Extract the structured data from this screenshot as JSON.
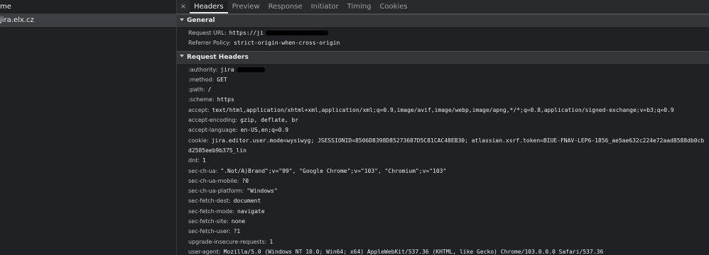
{
  "list": {
    "header": "me",
    "items": [
      {
        "label": "jira.elx.cz"
      }
    ]
  },
  "tabs": {
    "close": "×",
    "items": [
      {
        "label": "Headers",
        "active": true
      },
      {
        "label": "Preview"
      },
      {
        "label": "Response"
      },
      {
        "label": "Initiator"
      },
      {
        "label": "Timing"
      },
      {
        "label": "Cookies"
      }
    ]
  },
  "general": {
    "title": "General",
    "rows": [
      {
        "key": "Request URL:",
        "value": "https://ji"
      },
      {
        "key": "Referrer Policy:",
        "value": "strict-origin-when-cross-origin"
      }
    ]
  },
  "request_headers": {
    "title": "Request Headers",
    "rows": [
      {
        "key": ":authority:",
        "value": "jira"
      },
      {
        "key": ":method:",
        "value": "GET"
      },
      {
        "key": ":path:",
        "value": "/"
      },
      {
        "key": ":scheme:",
        "value": "https"
      },
      {
        "key": "accept:",
        "value": "text/html,application/xhtml+xml,application/xml;q=0.9,image/avif,image/webp,image/apng,*/*;q=0.8,application/signed-exchange;v=b3;q=0.9"
      },
      {
        "key": "accept-encoding:",
        "value": "gzip, deflate, br"
      },
      {
        "key": "accept-language:",
        "value": "en-US,en;q=0.9"
      },
      {
        "key": "cookie:",
        "value": "jira.editor.user.mode=wysiwyg; JSESSIONID=8506D8398D85273687D5C81CAC48EB30; atlassian.xsrf.token=BIUE-FNAV-LEP6-1856_ae5ae632c224e72aad8588db0cbd2585eeb9b375_lin"
      },
      {
        "key": "dnt:",
        "value": "1"
      },
      {
        "key": "sec-ch-ua:",
        "value": "\".Not/A)Brand\";v=\"99\", \"Google Chrome\";v=\"103\", \"Chromium\";v=\"103\""
      },
      {
        "key": "sec-ch-ua-mobile:",
        "value": "?0"
      },
      {
        "key": "sec-ch-ua-platform:",
        "value": "\"Windows\""
      },
      {
        "key": "sec-fetch-dest:",
        "value": "document"
      },
      {
        "key": "sec-fetch-mode:",
        "value": "navigate"
      },
      {
        "key": "sec-fetch-site:",
        "value": "none"
      },
      {
        "key": "sec-fetch-user:",
        "value": "?1"
      },
      {
        "key": "upgrade-insecure-requests:",
        "value": "1"
      },
      {
        "key": "user-agent:",
        "value": "Mozilla/5.0 (Windows NT 10.0; Win64; x64) AppleWebKit/537.36 (KHTML, like Gecko) Chrome/103.0.0.0 Safari/537.36"
      }
    ]
  },
  "colors": {
    "background": "#202124",
    "selected_row": "#3c4043",
    "section_header": "#35363a",
    "key_text": "#bdc1c6",
    "value_text": "#e8eaed"
  }
}
